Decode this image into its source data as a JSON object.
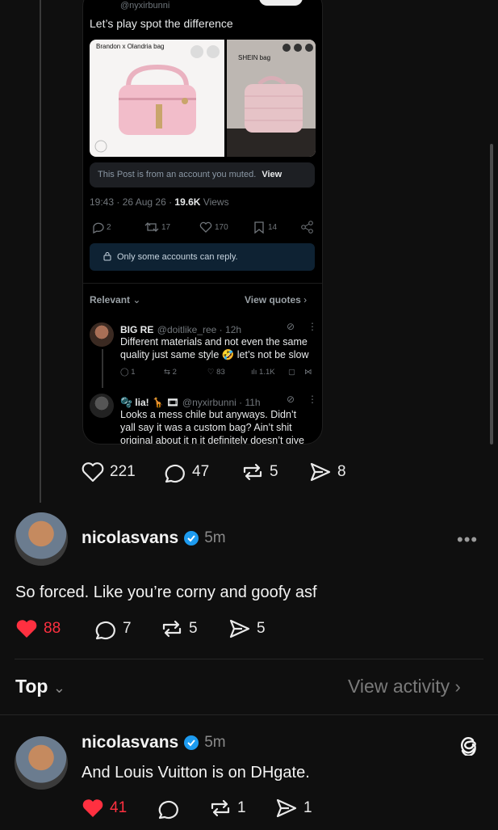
{
  "embedded_post": {
    "handle": "@nyxirbunni",
    "text": "Let’s play spot the difference",
    "image1_label": "Brandon x Olandria bag",
    "image2_label": "SHEIN bag",
    "muted_notice": "This Post is from an account you muted.",
    "muted_view": "View",
    "meta_time": "19:43 · 26 Aug 26 · ",
    "meta_views_count": "19.6K",
    "meta_views_label": " Views",
    "stats": {
      "replies": "2",
      "reposts": "17",
      "likes": "170",
      "bookmarks": "14"
    },
    "reply_notice": "Only some accounts can reply.",
    "sort_label": "Relevant",
    "view_quotes": "View quotes",
    "comments": [
      {
        "name": "BIG RE",
        "handle": "@doitlike_ree · 12h",
        "text": "Different materials and not even the same quality just same style 🤣 let’s not be slow",
        "replies": "1",
        "reposts": "2",
        "likes": "83",
        "views": "1.1K"
      },
      {
        "name": "🫧 lia! 🦒 🎞",
        "handle": "@nyxirbunni · 11h",
        "text": "Looks a mess chile but anyways. Didn’t yall say it was a custom bag? Ain’t shit original about it n it definitely doesn’t give designer"
      }
    ]
  },
  "outer_post_actions": {
    "likes": "221",
    "comments": "47",
    "reposts": "5",
    "shares": "8"
  },
  "reply1": {
    "username": "nicolasvans",
    "time": "5m",
    "text": "So forced. Like you’re corny and goofy asf",
    "likes": "88",
    "comments": "7",
    "reposts": "5",
    "shares": "5"
  },
  "sort_bar": {
    "top": "Top",
    "view_activity": "View activity"
  },
  "reply2": {
    "username": "nicolasvans",
    "time": "5m",
    "text": "And Louis Vuitton is on DHgate.",
    "likes": "41",
    "comments": "",
    "reposts": "1",
    "shares": "1"
  },
  "colors": {
    "background": "#0f0f0f",
    "like_red": "#ff3040",
    "verified_blue": "#1d9bf0"
  }
}
